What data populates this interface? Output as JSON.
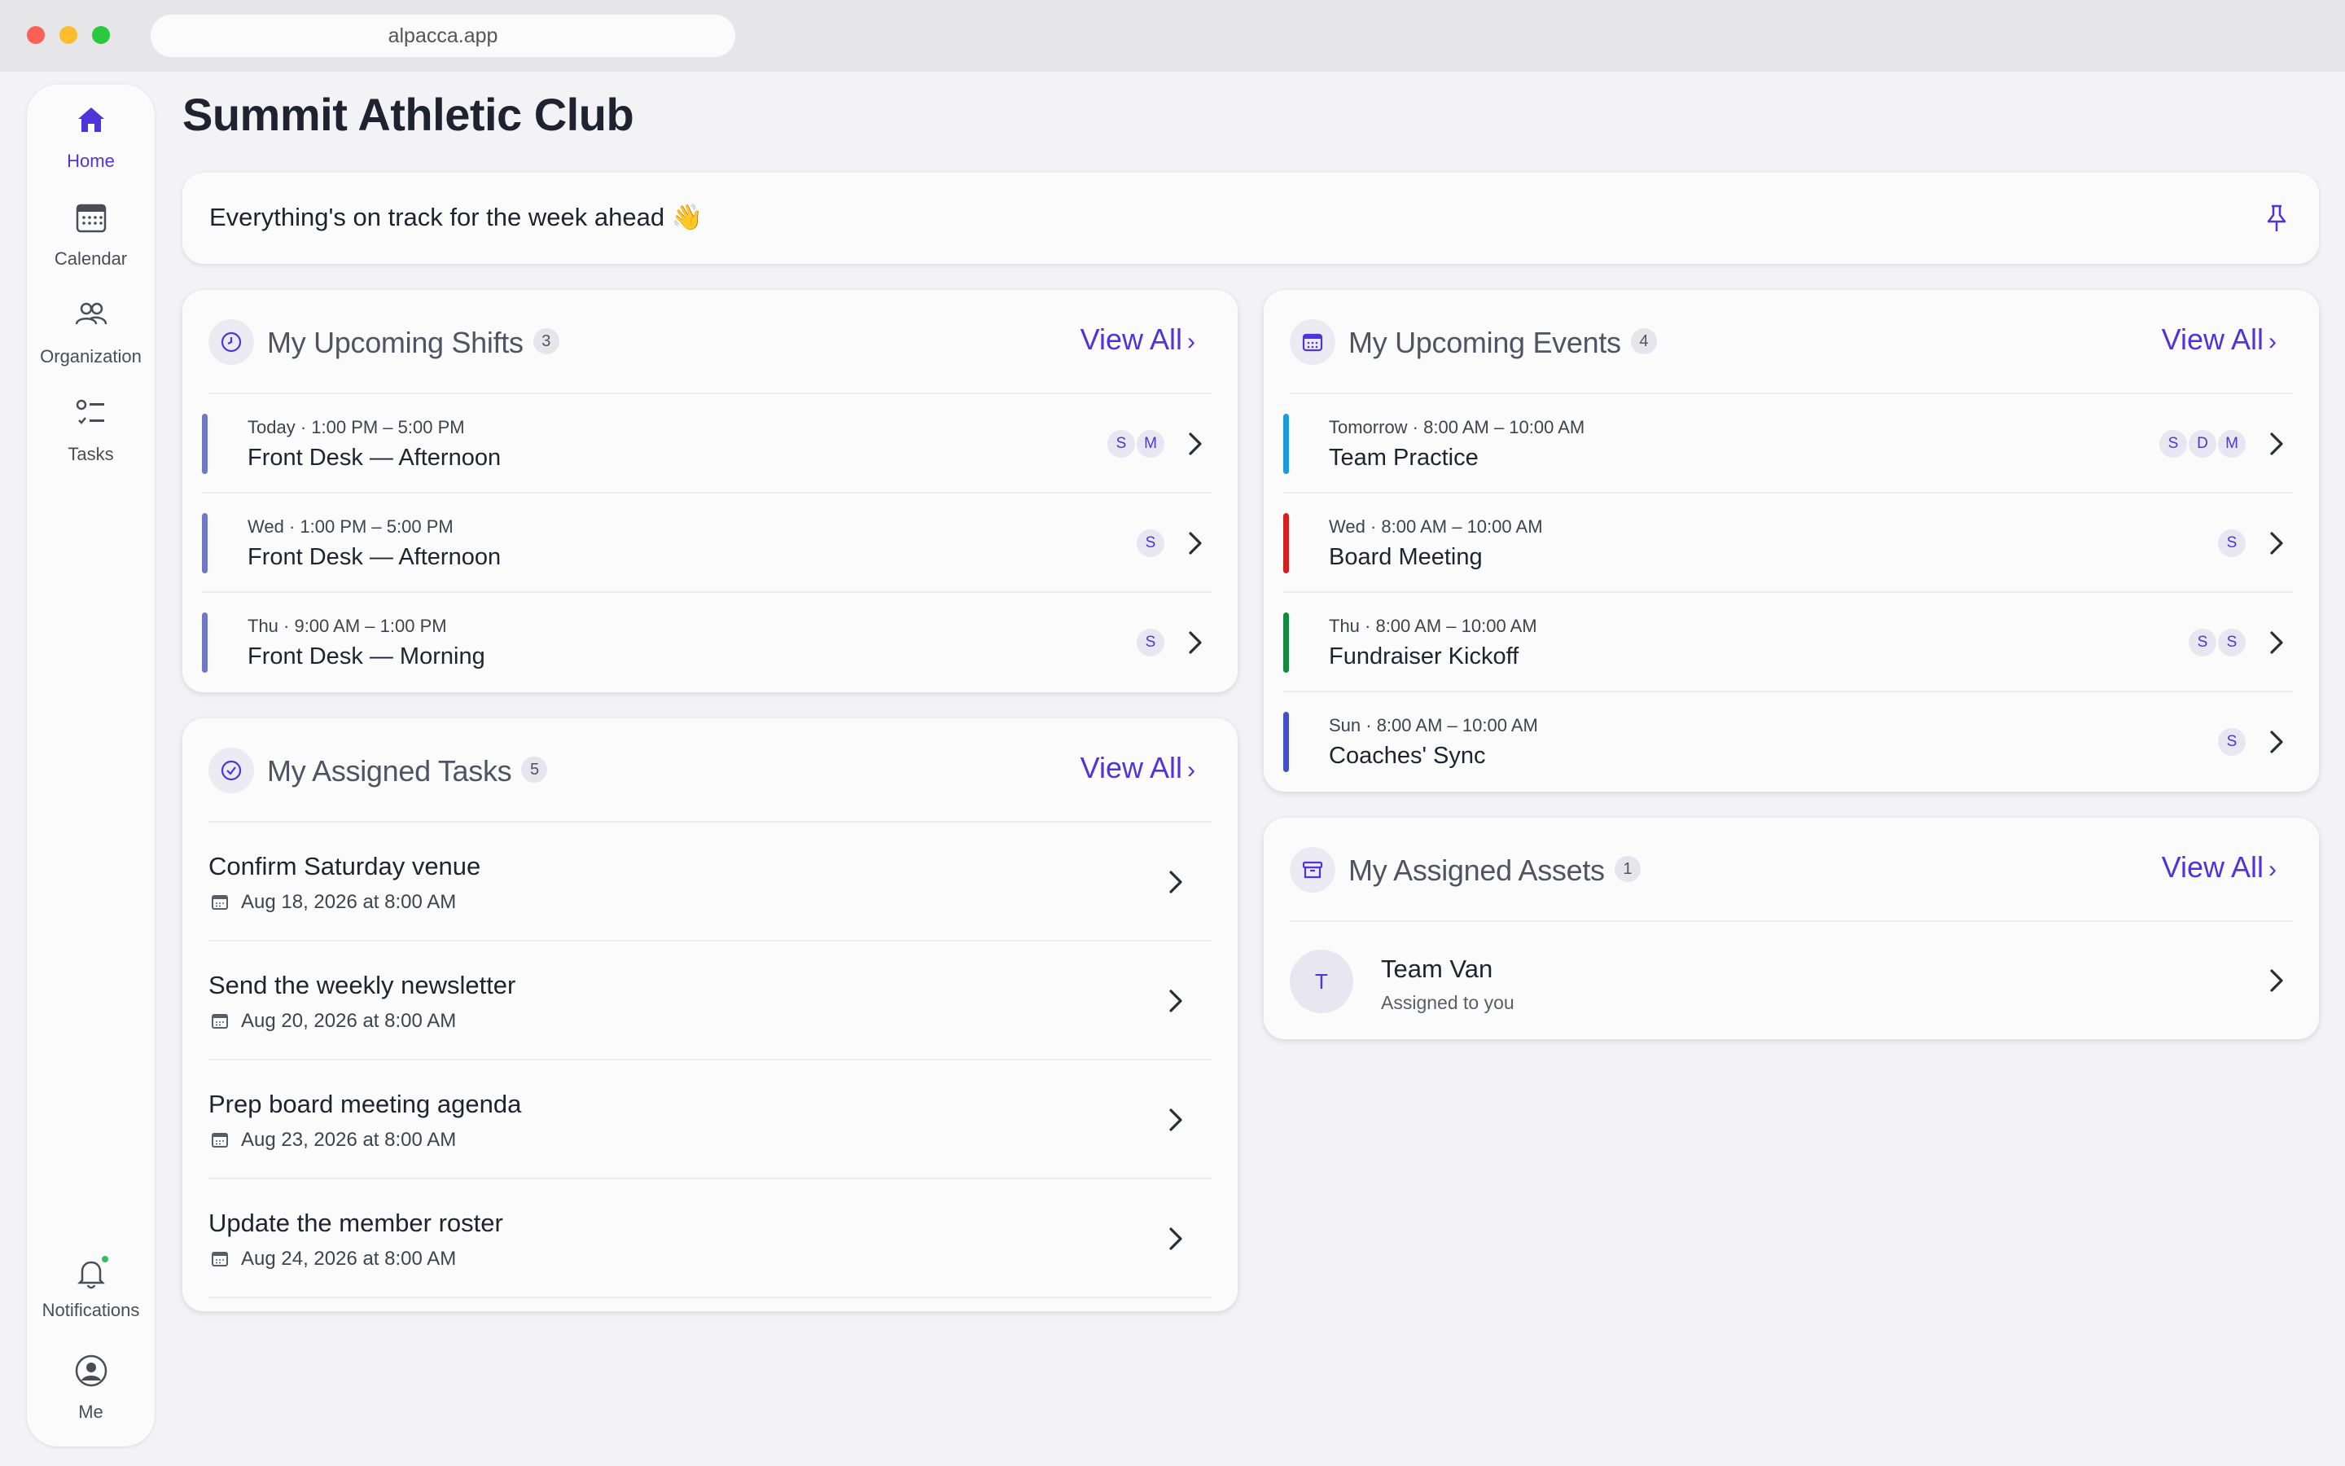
{
  "browser": {
    "url": "alpacca.app"
  },
  "sidebar": {
    "items": [
      {
        "label": "Home",
        "icon": "home-icon",
        "active": true
      },
      {
        "label": "Calendar",
        "icon": "calendar-icon"
      },
      {
        "label": "Organization",
        "icon": "people-icon"
      },
      {
        "label": "Tasks",
        "icon": "tasks-icon"
      }
    ],
    "bottom": [
      {
        "label": "Notifications",
        "icon": "bell-icon"
      },
      {
        "label": "Me",
        "icon": "user-icon"
      }
    ]
  },
  "page": {
    "title": "Summit Athletic Club"
  },
  "banner": {
    "text": "Everything's on track for the week ahead 👋",
    "pin_icon": "pin-icon"
  },
  "shifts": {
    "title": "My Upcoming Shifts",
    "count": "3",
    "view_all": "View All",
    "items": [
      {
        "when": "Today · 1:00 PM – 5:00 PM",
        "title": "Front Desk — Afternoon",
        "avatars": [
          "S",
          "M"
        ],
        "color": "#6f78c7"
      },
      {
        "when": "Wed · 1:00 PM – 5:00 PM",
        "title": "Front Desk — Afternoon",
        "avatars": [
          "S"
        ],
        "color": "#6f78c7"
      },
      {
        "when": "Thu · 9:00 AM – 1:00 PM",
        "title": "Front Desk — Morning",
        "avatars": [
          "S"
        ],
        "color": "#6f78c7"
      }
    ]
  },
  "events": {
    "title": "My Upcoming Events",
    "count": "4",
    "view_all": "View All",
    "items": [
      {
        "when": "Tomorrow · 8:00 AM – 10:00 AM",
        "title": "Team Practice",
        "avatars": [
          "S",
          "D",
          "M"
        ],
        "color": "#1e9be0"
      },
      {
        "when": "Wed · 8:00 AM – 10:00 AM",
        "title": "Board Meeting",
        "avatars": [
          "S"
        ],
        "color": "#d41f1f"
      },
      {
        "when": "Thu · 8:00 AM – 10:00 AM",
        "title": "Fundraiser Kickoff",
        "avatars": [
          "S",
          "S"
        ],
        "color": "#138a3e"
      },
      {
        "when": "Sun · 8:00 AM – 10:00 AM",
        "title": "Coaches' Sync",
        "avatars": [
          "S"
        ],
        "color": "#4451c4"
      }
    ]
  },
  "tasks": {
    "title": "My Assigned Tasks",
    "count": "5",
    "view_all": "View All",
    "items": [
      {
        "title": "Confirm Saturday venue",
        "due": "Aug 18, 2026 at 8:00 AM"
      },
      {
        "title": "Send the weekly newsletter",
        "due": "Aug 20, 2026 at 8:00 AM"
      },
      {
        "title": "Prep board meeting agenda",
        "due": "Aug 23, 2026 at 8:00 AM"
      },
      {
        "title": "Update the member roster",
        "due": "Aug 24, 2026 at 8:00 AM"
      }
    ]
  },
  "assets": {
    "title": "My Assigned Assets",
    "count": "1",
    "view_all": "View All",
    "items": [
      {
        "initial": "T",
        "title": "Team Van",
        "subtitle": "Assigned to you"
      }
    ]
  },
  "colors": {
    "accent": "#4f35d9",
    "online": "#2fc160"
  }
}
